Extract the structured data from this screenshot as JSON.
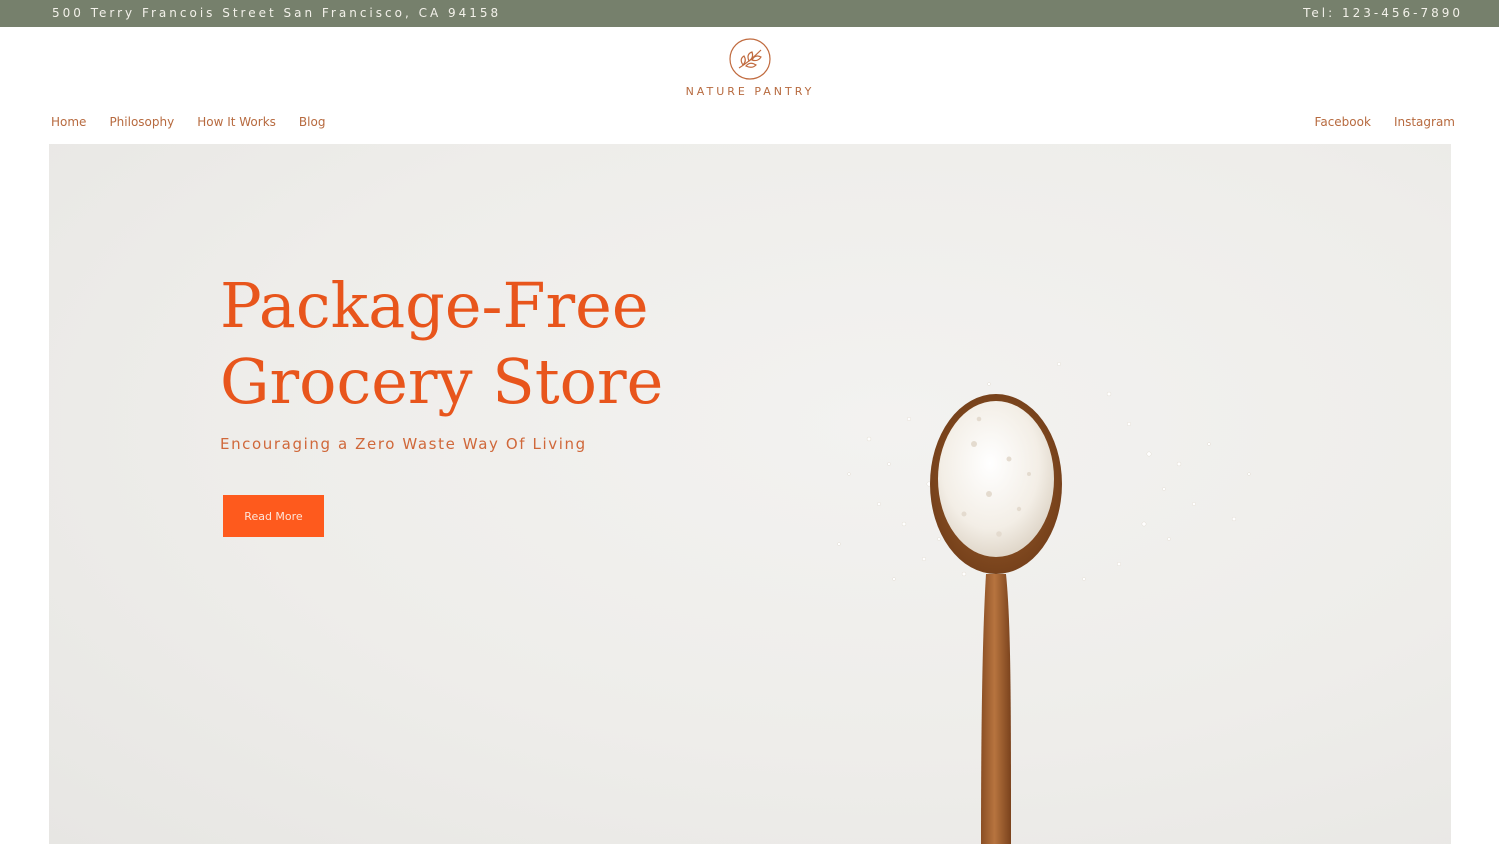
{
  "topbar": {
    "address": "500 Terry Francois Street San Francisco, CA 94158",
    "phone": "Tel: 123-456-7890"
  },
  "logo": {
    "icon": "leaf-branch-icon",
    "brand": "NATURE PANTRY"
  },
  "nav": {
    "left": [
      {
        "label": "Home"
      },
      {
        "label": "Philosophy"
      },
      {
        "label": "How It Works"
      },
      {
        "label": "Blog"
      }
    ],
    "right": [
      {
        "label": "Facebook"
      },
      {
        "label": "Instagram"
      }
    ]
  },
  "hero": {
    "headline_line1": "Package-Free",
    "headline_line2": "Grocery Store",
    "subheadline": "Encouraging a Zero Waste Way Of Living",
    "cta_label": "Read More",
    "image": "wooden-spoon-with-coconut-flakes"
  },
  "colors": {
    "topbar_bg": "#76806c",
    "accent": "#fe5a1d",
    "headline": "#e8551c",
    "nav_text": "#b76a3f"
  }
}
